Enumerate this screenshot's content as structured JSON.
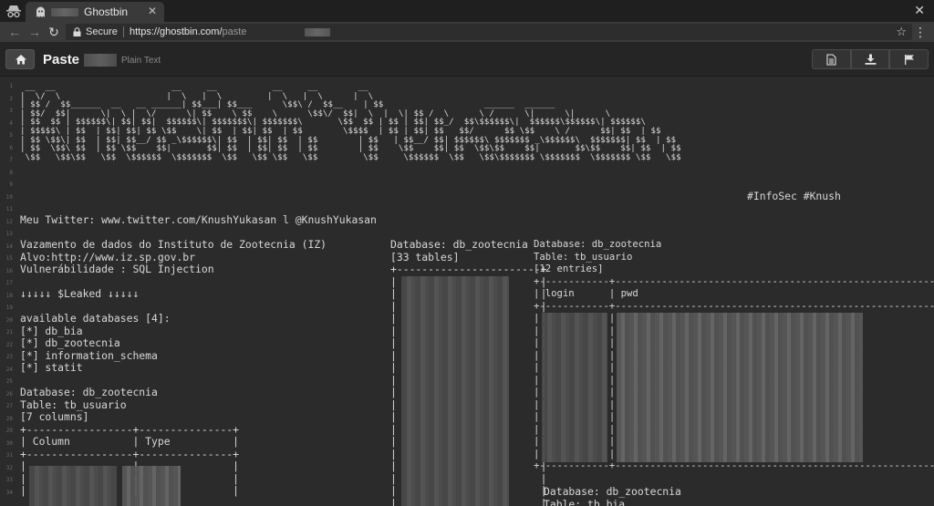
{
  "browser": {
    "tab_title": "Ghostbin",
    "security_label": "Secure",
    "url_origin": "https://ghostbin.com/",
    "url_path": "paste"
  },
  "page": {
    "title": "Paste",
    "language": "Plain Text"
  },
  "icons": {
    "home": "home-icon",
    "raw": "document-icon",
    "download": "download-icon",
    "report": "flag-icon"
  },
  "paste": {
    "banner": " __  __                       __     __           __     __        __\n|  \\/  \\                     |  \\   |  \\         |  \\   |  \\      |  \\\n| $$ /  $$______  __   __ ______| $$___| $$___      \\$$\\ /  $$__    | $$                    ______  ______\n| $$/  $$|      \\|  \\ |  \\/      \\| $$    \\ $$    \\      \\$$\\/  $$|  \\  |  \\| $$ /  \\      \\ /      \\|      \\|      \\\n| $$  $$ | $$$$$$\\| $$| $$|  $$$$$$\\| $$$$$$$\\| $$$$$$$\\       \\$$  $$ | $$ | $$| $$_/  $$\\$$$$$$\\|  $$$$$$\\$$$$$$\\| $$$$$$\\\n| $$$$$\\ | $$  | $$| $$| $$ \\$$    \\| $$  | $$| $$  | $$        \\$$$$  | $$ | $$| $$   $$/      $$ \\$$    \\ /      $$| $$  | $$\n| $$ \\$$\\| $$  | $$| $$__/ $$ _\\$$$$$$\\| $$  | $$| $$  | $$        | $$   | $$__/ $$| $$$$$$\\ $$$$$$$ _\\$$$$$$\\  $$$$$$$| $$  | $$\n| $$  \\$$\\ $$  | $$ \\$$    $$|       $$| $$  | $$| $$  | $$        | $$    \\$$    $$| $$  \\$$\\$$    $$|       $$\\$$    $$| $$  | $$\n \\$$   \\$$\\$$   \\$$  \\$$$$$$  \\$$$$$$$  \\$$   \\$$ \\$$   \\$$         \\$$     \\$$$$$$  \\$$   \\$$\\$$$$$$$ \\$$$$$$$  \\$$$$$$$ \\$$   \\$$",
    "tags": "#InfoSec #Knush",
    "twitter": "Meu Twitter: www.twitter.com/KnushYukasan l @KnushYukasan",
    "intro": "Vazamento de dados do Instituto de Zootecnia (IZ)\nAlvo:http://www.iz.sp.gov.br\nVulnerábilidade : SQL Injection",
    "leaked": "↓↓↓↓↓ $Leaked ↓↓↓↓↓",
    "databases": "available databases [4]:\n[*] db_bia\n[*] db_zootecnia\n[*] information_schema\n[*] statit",
    "columns_block": "Database: db_zootecnia\nTable: tb_usuario\n[7 columns]\n+-----------------+---------------+\n| Column          | Type          |\n+-----------------+---------------+\n|                 |               |\n|                 |               |\n|                 |               |",
    "tables_block": "Database: db_zootecnia\n[33 tables]\n+-----------------------+\n|                       |\n|                       |\n|                       |\n|                       |\n|                       |\n|                       |\n|                       |\n|                       |\n|                       |\n|                       |\n|                       |\n|                       |\n|                       |\n|                       |\n|                       |\n|                       |\n|                       |\n|                       |\n|                       |\n|                       |",
    "entries_block": "Database: db_zootecnia\nTable: tb_usuario\n[12 entries]\n+------------+-----------------------------------------------------------------------------+\n| login      | pwd                                                                         |\n+------------+-----------------------------------------------------------------------------+\n|            |                                                                             |\n|            |                                                                             |\n|            |                                                                             |\n|            |                                                                             |\n|            |                                                                             |\n|            |                                                                             |\n|            |                                                                             |\n|            |                                                                             |\n|            |                                                                             |\n|            |                                                                             |\n|            |                                                                             |\n|            |                                                                             |\n+------------+-----------------------------------------------------------------------------+",
    "next_block": "Database: db_zootecnia\nTable: tb_bia",
    "line_numbers": [
      "1",
      "2",
      "3",
      "4",
      "5",
      "6",
      "7",
      "8",
      "9",
      "10",
      "11",
      "12",
      "13",
      "14",
      "15",
      "16",
      "17",
      "18",
      "19",
      "20",
      "21",
      "22",
      "23",
      "24",
      "25",
      "26",
      "27",
      "28",
      "29",
      "30",
      "31",
      "32",
      "33",
      "34"
    ]
  }
}
